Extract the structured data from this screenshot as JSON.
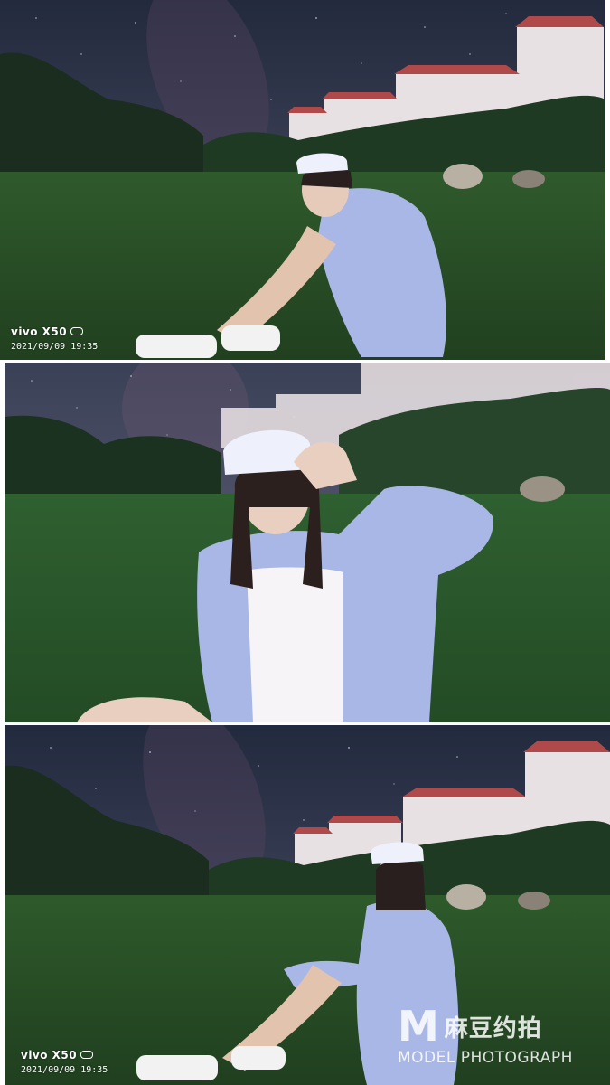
{
  "photos": [
    {
      "scene": "night-lawn-sitting",
      "camera_model": "vivo X50",
      "camera_badge": "5G",
      "timestamp": "2021/09/09 19:35"
    },
    {
      "scene": "night-lawn-closeup"
    },
    {
      "scene": "night-lawn-sitting",
      "camera_model": "vivo X50",
      "camera_badge": "5G",
      "timestamp": "2021/09/09 19:35"
    }
  ],
  "watermark": {
    "logo": "M",
    "brand_cn": "麻豆约拍",
    "brand_en": "MODEL PHOTOGRAPH"
  },
  "colors": {
    "sky": "#2b3247",
    "grass": "#2f5a2c",
    "hoodie": "#a9b7e6",
    "cap": "#eef0fb"
  }
}
